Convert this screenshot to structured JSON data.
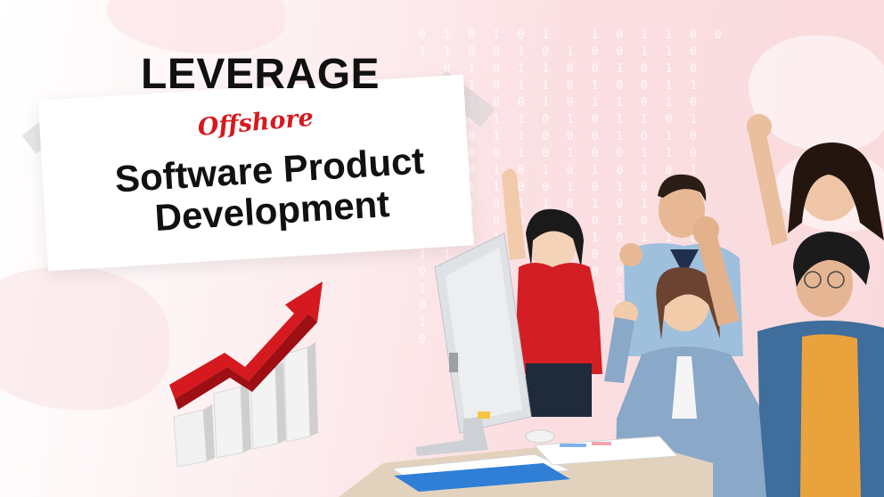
{
  "banner": {
    "heading": "LEVERAGE",
    "accent_word": "Offshore",
    "title_line1": "Software Product",
    "title_line2": "Development"
  },
  "colors": {
    "accent_red": "#d6191f",
    "text_dark": "#111111",
    "background_pink": "#fadadd"
  },
  "icons": {
    "growth": "growth-chart-arrow-icon",
    "monitor": "monitor-icon"
  }
}
